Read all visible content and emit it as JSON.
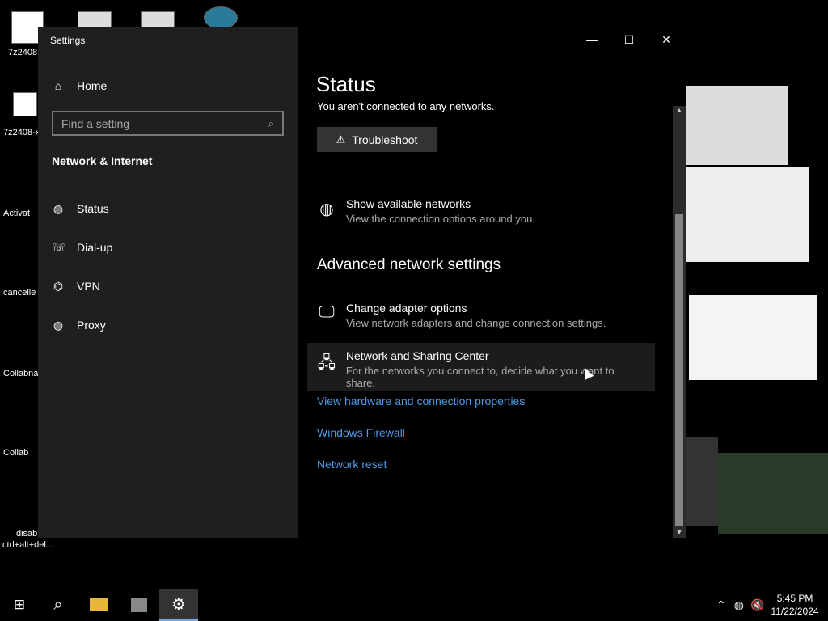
{
  "desktop": {
    "icon_label_top": "7z2408",
    "label_activat": "Activat",
    "label_cancelle": "cancelle",
    "label_collab1": "Collabna",
    "label_collab2": "Collab",
    "label_disab": "disab",
    "ctrl_alt_del": "ctrl+alt+del...",
    "label_7z_2": "7z2408-x"
  },
  "window": {
    "title": "Settings",
    "minimize_icon": "minimize-icon",
    "maximize_icon": "maximize-icon",
    "close_icon": "close-icon"
  },
  "nav": {
    "home_label": "Home",
    "search_placeholder": "Find a setting",
    "section_title": "Network & Internet",
    "items": [
      {
        "label": "Status",
        "icon": "globe-icon"
      },
      {
        "label": "Dial-up",
        "icon": "phone-icon"
      },
      {
        "label": "VPN",
        "icon": "vpn-icon"
      },
      {
        "label": "Proxy",
        "icon": "globe-icon"
      }
    ]
  },
  "content": {
    "page_title": "Status",
    "status_text": "You aren't connected to any networks.",
    "troubleshoot_label": "Troubleshoot",
    "show_networks": {
      "title": "Show available networks",
      "desc": "View the connection options around you."
    },
    "advanced_title": "Advanced network settings",
    "adapter_options": {
      "title": "Change adapter options",
      "desc": "View network adapters and change connection settings."
    },
    "sharing_center": {
      "title": "Network and Sharing Center",
      "desc": "For the networks you connect to, decide what you want to share."
    },
    "links": [
      "View hardware and connection properties",
      "Windows Firewall",
      "Network reset"
    ]
  },
  "taskbar": {
    "start_icon": "windows-start-icon",
    "search_icon": "search-icon",
    "explorer_icon": "file-explorer-icon",
    "network_app_icon": "network-app-icon",
    "settings_icon": "gear-icon",
    "time": "5:45 PM",
    "date": "11/22/2024"
  },
  "colors": {
    "accent_link": "#4c9be8",
    "nav_bg": "#1f1f1f",
    "content_bg": "#000000"
  }
}
